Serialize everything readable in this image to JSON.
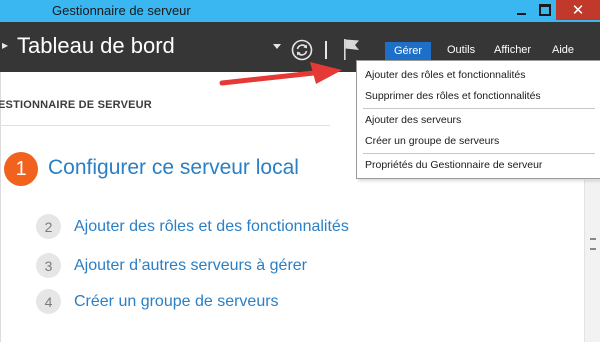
{
  "window": {
    "title": "Gestionnaire de serveur",
    "close_glyph": "✕"
  },
  "header": {
    "nav_arrow": "▸",
    "title": "Tableau de bord",
    "menus": {
      "gerer": "Gérer",
      "outils": "Outils",
      "afficher": "Afficher",
      "aide": "Aide"
    }
  },
  "main": {
    "section_heading": "ESTIONNAIRE DE SERVEUR",
    "steps": [
      {
        "number": "1",
        "label": "Configurer ce serveur local"
      },
      {
        "number": "2",
        "label": "Ajouter des rôles et des fonctionnalités"
      },
      {
        "number": "3",
        "label": "Ajouter d’autres serveurs à gérer"
      },
      {
        "number": "4",
        "label": "Créer un groupe de serveurs"
      }
    ]
  },
  "dropdown": {
    "items": [
      "Ajouter des rôles et fonctionnalités",
      "Supprimer des rôles et fonctionnalités",
      "Ajouter des serveurs",
      "Créer un groupe de serveurs",
      "Propriétés du Gestionnaire de serveur"
    ]
  },
  "colors": {
    "titlebar": "#3ab6f0",
    "header": "#363636",
    "accent_orange": "#f0621e",
    "link_blue": "#2a7fc5",
    "menu_highlight": "#1e6fc7",
    "arrow_red": "#e53935"
  },
  "icons": [
    "refresh-icon",
    "flag-icon",
    "minimize-icon",
    "maximize-icon",
    "close-icon",
    "scroll-grip-icon"
  ]
}
